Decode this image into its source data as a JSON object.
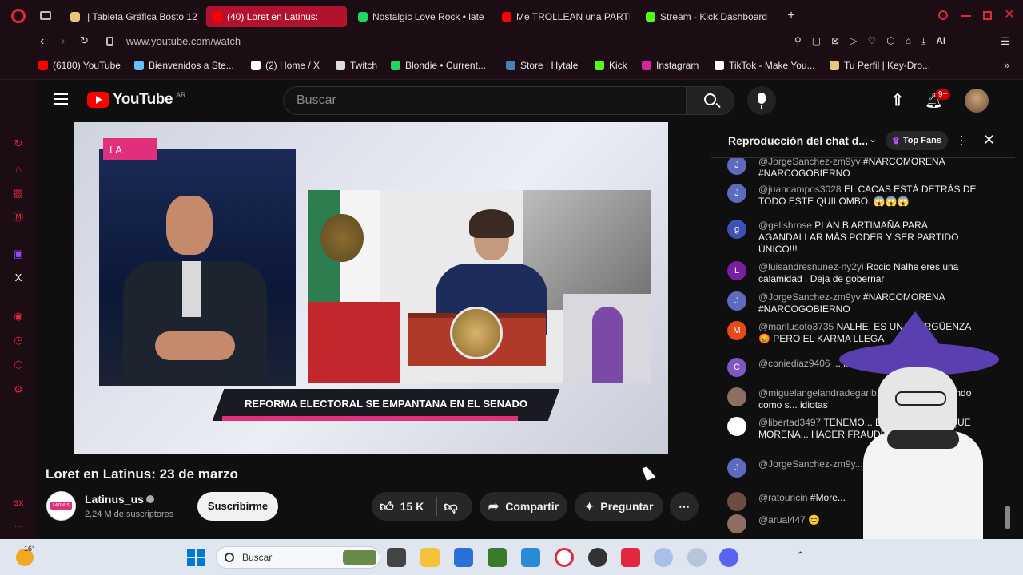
{
  "browser": {
    "tabs": [
      {
        "label": "|| Tableta Gráfica Bosto 12",
        "icon": "tablet-icon",
        "color": "#e8c77a"
      },
      {
        "label": "(40) Loret en Latinus:",
        "icon": "youtube-icon",
        "color": "#ff0000",
        "active": true
      },
      {
        "label": "Nostalgic Love Rock • late",
        "icon": "spotify-icon",
        "color": "#1ed760"
      },
      {
        "label": "Me TROLLEAN una PARTI",
        "icon": "youtube-icon",
        "color": "#ff0000"
      },
      {
        "label": "Stream - Kick Dashboard",
        "icon": "kick-icon",
        "color": "#53fc18"
      }
    ],
    "url": "www.youtube.com/watch",
    "ai_label": "AI",
    "bookmarks": [
      {
        "label": "(6180) YouTube",
        "color": "#ff0000"
      },
      {
        "label": "Bienvenidos a Ste...",
        "color": "#66c0f4"
      },
      {
        "label": "(2) Home / X",
        "color": "#ffffff"
      },
      {
        "label": "Twitch",
        "color": "#dddddd"
      },
      {
        "label": "Blondie • Current...",
        "color": "#1ed760"
      },
      {
        "label": "Store | Hytale",
        "color": "#4a7fb8"
      },
      {
        "label": "Kick",
        "color": "#53fc18"
      },
      {
        "label": "Instagram",
        "color": "#d6249f"
      },
      {
        "label": "TikTok - Make You...",
        "color": "#ffffff"
      },
      {
        "label": "Tu Perfil | Key-Dro...",
        "color": "#e8c77a"
      }
    ]
  },
  "youtube": {
    "logo_text": "YouTube",
    "region": "AR",
    "search_placeholder": "Buscar",
    "notification_count": "9+",
    "video": {
      "corner_tag": "LA",
      "banner": "REFORMA ELECTORAL SE EMPANTANA EN EL SENADO",
      "title": "Loret en Latinus: 23 de marzo"
    },
    "channel": {
      "name": "Latinus_us",
      "subscribers": "2,24 M de suscriptores",
      "subscribe_label": "Suscribirme",
      "logo_text": "LATINUS"
    },
    "actions": {
      "likes": "15 K",
      "share": "Compartir",
      "ask": "Preguntar"
    }
  },
  "chat": {
    "header": "Reproducción del chat d...",
    "filter": "Top Fans",
    "messages": [
      {
        "initial": "J",
        "color": "#5c6bc0",
        "author": "@JorgeSanchez-zm9yv",
        "text": "#NARCOMORENA #NARCOGOBIERNO"
      },
      {
        "initial": "J",
        "color": "#5c6bc0",
        "author": "@juancampos3028",
        "text": "EL CACAS ESTÁ DETRÁS DE TODO ESTE QUILOMBO. 😱😱😱"
      },
      {
        "initial": "g",
        "color": "#3f51b5",
        "author": "@gelishrose",
        "text": "PLAN B ARTIMAÑA PARA AGANDALLAR MÁS PODER Y SER PARTIDO ÚNICO!!!"
      },
      {
        "initial": "L",
        "color": "#7b1fa2",
        "author": "@luisandresnunez-ny2yi",
        "text": "Rocio Nalhe eres una calamidad . Deja de gobernar"
      },
      {
        "initial": "J",
        "color": "#5c6bc0",
        "author": "@JorgeSanchez-zm9yv",
        "text": "#NARCOMORENA #NARCOGOBIERNO"
      },
      {
        "initial": "M",
        "color": "#e64a19",
        "author": "@marilusoto3735",
        "text": "NALHE, ES UNA VERGÜENZA 😡 PERO EL KARMA LLEGA"
      },
      {
        "initial": "C",
        "color": "#7e57c2",
        "author": "@coniediaz9406",
        "text": "... las bolsas de plás..."
      },
      {
        "initial": "",
        "color": "#8d6e63",
        "author": "@miguelangelandradegarib...",
        "text": "...siempre hablando como s... idiotas"
      },
      {
        "initial": "",
        "color": "#ffffff",
        "author": "@libertad3497",
        "text": "TENEMO... EN EL 2027 PORQUE MORENA... HACER FRAUDE ELECTO..."
      },
      {
        "initial": "J",
        "color": "#5c6bc0",
        "author": "@JorgeSanchez-zm9y...",
        "text": "#NARCOGOBIERNO"
      },
      {
        "initial": "",
        "color": "#6d4c41",
        "author": "@ratouncin",
        "text": "#More..."
      },
      {
        "initial": "",
        "color": "#8d6e63",
        "author": "@arual447",
        "text": "😊"
      }
    ]
  },
  "taskbar": {
    "weather": "16°",
    "search_placeholder": "Buscar"
  }
}
